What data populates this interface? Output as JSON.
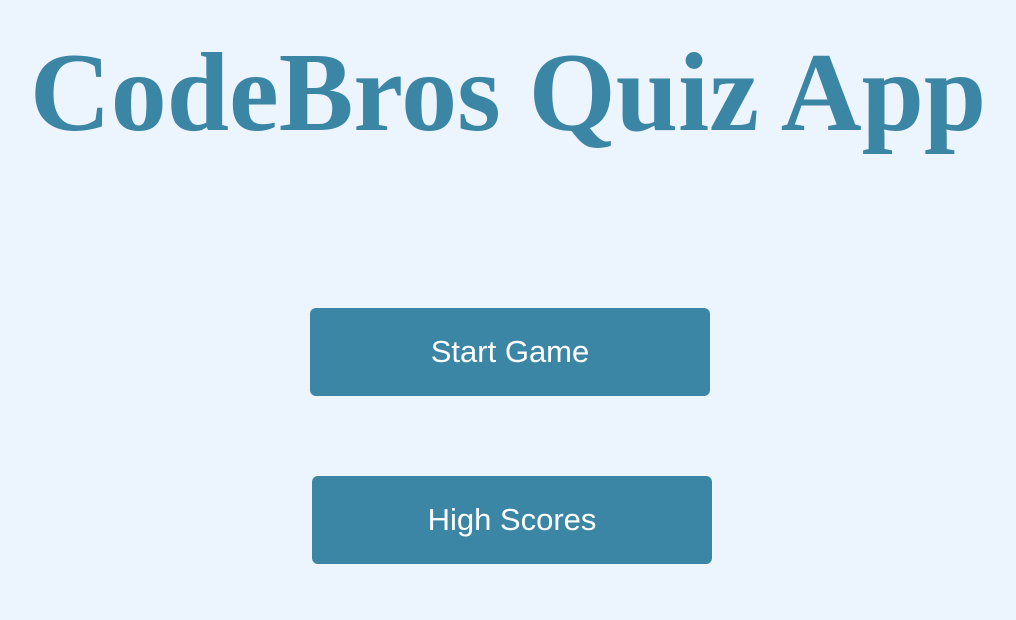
{
  "app": {
    "title": "CodeBros Quiz App"
  },
  "menu": {
    "start_label": "Start Game",
    "scores_label": "High Scores"
  },
  "colors": {
    "background": "#ecf4fe",
    "accent": "#3b85a5",
    "button_text": "#ffffff"
  }
}
